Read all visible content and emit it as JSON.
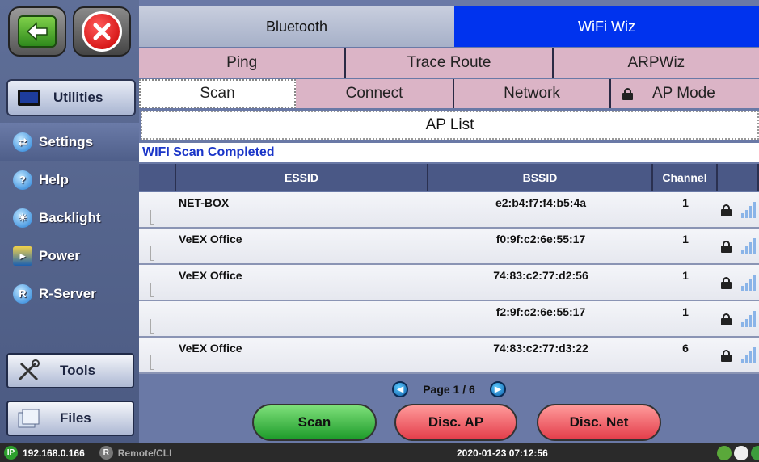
{
  "sidebar": {
    "utilities_label": "Utilities",
    "menu": [
      {
        "label": "Settings",
        "icon": "settings-icon"
      },
      {
        "label": "Help",
        "icon": "help-icon"
      },
      {
        "label": "Backlight",
        "icon": "backlight-icon"
      },
      {
        "label": "Power",
        "icon": "power-icon"
      },
      {
        "label": "R-Server",
        "icon": "r-server-icon"
      }
    ],
    "tools_label": "Tools",
    "files_label": "Files"
  },
  "tabs": {
    "top": {
      "bluetooth": "Bluetooth",
      "wifiwiz": "WiFi Wiz"
    },
    "second": {
      "ping": "Ping",
      "trace_route": "Trace Route",
      "arpwiz": "ARPWiz"
    },
    "third": {
      "scan": "Scan",
      "connect": "Connect",
      "network": "Network",
      "ap_mode": "AP Mode"
    }
  },
  "ap_list": {
    "title": "AP List",
    "status": "WIFI Scan Completed",
    "columns": [
      "ESSID",
      "BSSID",
      "Channel"
    ],
    "rows": [
      {
        "essid": "NET-BOX",
        "bssid": "e2:b4:f7:f4:b5:4a",
        "channel": "1"
      },
      {
        "essid": "VeEX Office",
        "bssid": "f0:9f:c2:6e:55:17",
        "channel": "1"
      },
      {
        "essid": "VeEX Office",
        "bssid": "74:83:c2:77:d2:56",
        "channel": "1"
      },
      {
        "essid": "",
        "bssid": "f2:9f:c2:6e:55:17",
        "channel": "1"
      },
      {
        "essid": "VeEX Office",
        "bssid": "74:83:c2:77:d3:22",
        "channel": "6"
      }
    ]
  },
  "pager": {
    "text": "Page 1 / 6"
  },
  "actions": {
    "scan": "Scan",
    "disc_ap": "Disc. AP",
    "disc_net": "Disc. Net"
  },
  "statusbar": {
    "ip_badge": "IP",
    "ip": "192.168.0.166",
    "r_badge": "R",
    "remote": "Remote/CLI",
    "datetime": "2020-01-23  07:12:56"
  },
  "colors": {
    "accent_blue": "#0033ee",
    "tab_pink": "#dbb4c6",
    "scan_green": "#1d9b2a",
    "disc_red": "#e33d4a"
  }
}
